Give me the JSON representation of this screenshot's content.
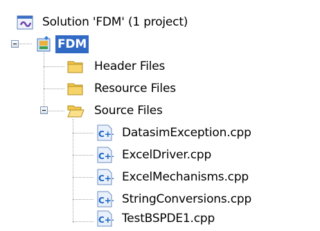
{
  "solution": {
    "label": "Solution 'FDM' (1 project)",
    "icon": "solution-icon"
  },
  "project": {
    "label": "FDM",
    "icon": "cpp-project-icon",
    "selected": true
  },
  "folders": [
    {
      "label": "Header Files",
      "icon": "folder-icon"
    },
    {
      "label": "Resource Files",
      "icon": "folder-icon"
    },
    {
      "label": "Source Files",
      "icon": "open-folder-icon",
      "expanded": true
    }
  ],
  "source_files": [
    {
      "label": "DatasimException.cpp",
      "icon": "cpp-file-icon"
    },
    {
      "label": "ExcelDriver.cpp",
      "icon": "cpp-file-icon"
    },
    {
      "label": "ExcelMechanisms.cpp",
      "icon": "cpp-file-icon"
    },
    {
      "label": "StringConversions.cpp",
      "icon": "cpp-file-icon"
    },
    {
      "label": "TestBSPDE1.cpp",
      "icon": "cpp-file-icon"
    }
  ],
  "colors": {
    "selection": "#316ac5",
    "folder": "#f4c84a",
    "cpp_icon": "#1a63c4"
  }
}
